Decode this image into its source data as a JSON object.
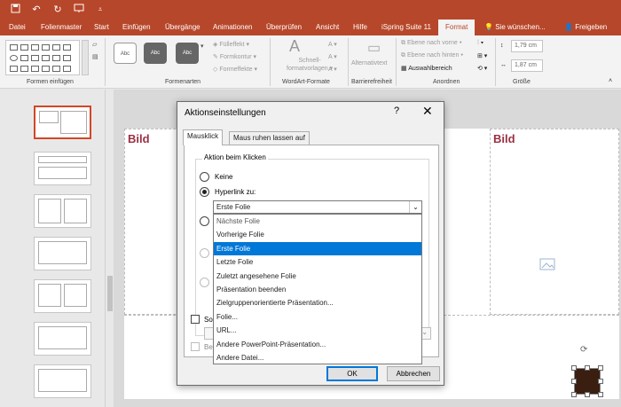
{
  "qat": {
    "save_icon": "save-icon",
    "undo_icon": "undo-icon",
    "redo_icon": "redo-icon",
    "start_icon": "present-icon"
  },
  "tabs": [
    "Datei",
    "Folienmaster",
    "Start",
    "Einfügen",
    "Übergänge",
    "Animationen",
    "Überprüfen",
    "Ansicht",
    "Hilfe",
    "iSpring Suite 11",
    "Format"
  ],
  "active_tab": "Format",
  "tell_me": "Sie wünschen...",
  "share": "Freigeben",
  "ribbon": {
    "groups": [
      "Formen einfügen",
      "Formenarten",
      "WordArt-Formate",
      "Barrierefreiheit",
      "Anordnen",
      "Größe"
    ],
    "style_samples": [
      "Abc",
      "Abc",
      "Abc"
    ],
    "fill": "Fülleffekt",
    "outline": "Formkontur",
    "effects": "Formeffekte",
    "quick_styles": [
      "Schnell-",
      "formatvorlagen"
    ],
    "alt_text": "Alternativtext",
    "bring_forward": "Ebene nach vorne",
    "send_backward": "Ebene nach hinten",
    "selection_pane": "Auswahlbereich",
    "height": "1,79 cm",
    "width": "1,87 cm"
  },
  "slide": {
    "title_left": "Bild",
    "title_right": "Bild"
  },
  "dialog": {
    "title": "Aktionseinstellungen",
    "help": "?",
    "close": "✕",
    "tabs": [
      "Mausklick",
      "Maus ruhen lassen auf"
    ],
    "group_label": "Aktion beim Klicken",
    "option_none": "Keine",
    "option_hyperlink": "Hyperlink zu:",
    "selected_value": "Erste Folie",
    "dropdown_items": [
      "Nächste Folie",
      "Vorherige Folie",
      "Erste Folie",
      "Letzte Folie",
      "Zuletzt angesehene Folie",
      "Präsentation beenden",
      "Zielgruppenorientierte Präsentation...",
      "Folie...",
      "URL...",
      "Andere PowerPoint-Präsentation...",
      "Andere Datei..."
    ],
    "highlighted_index": 2,
    "sound_label": "So",
    "highlight_label": "Be",
    "ok": "OK",
    "cancel": "Abbrechen"
  }
}
